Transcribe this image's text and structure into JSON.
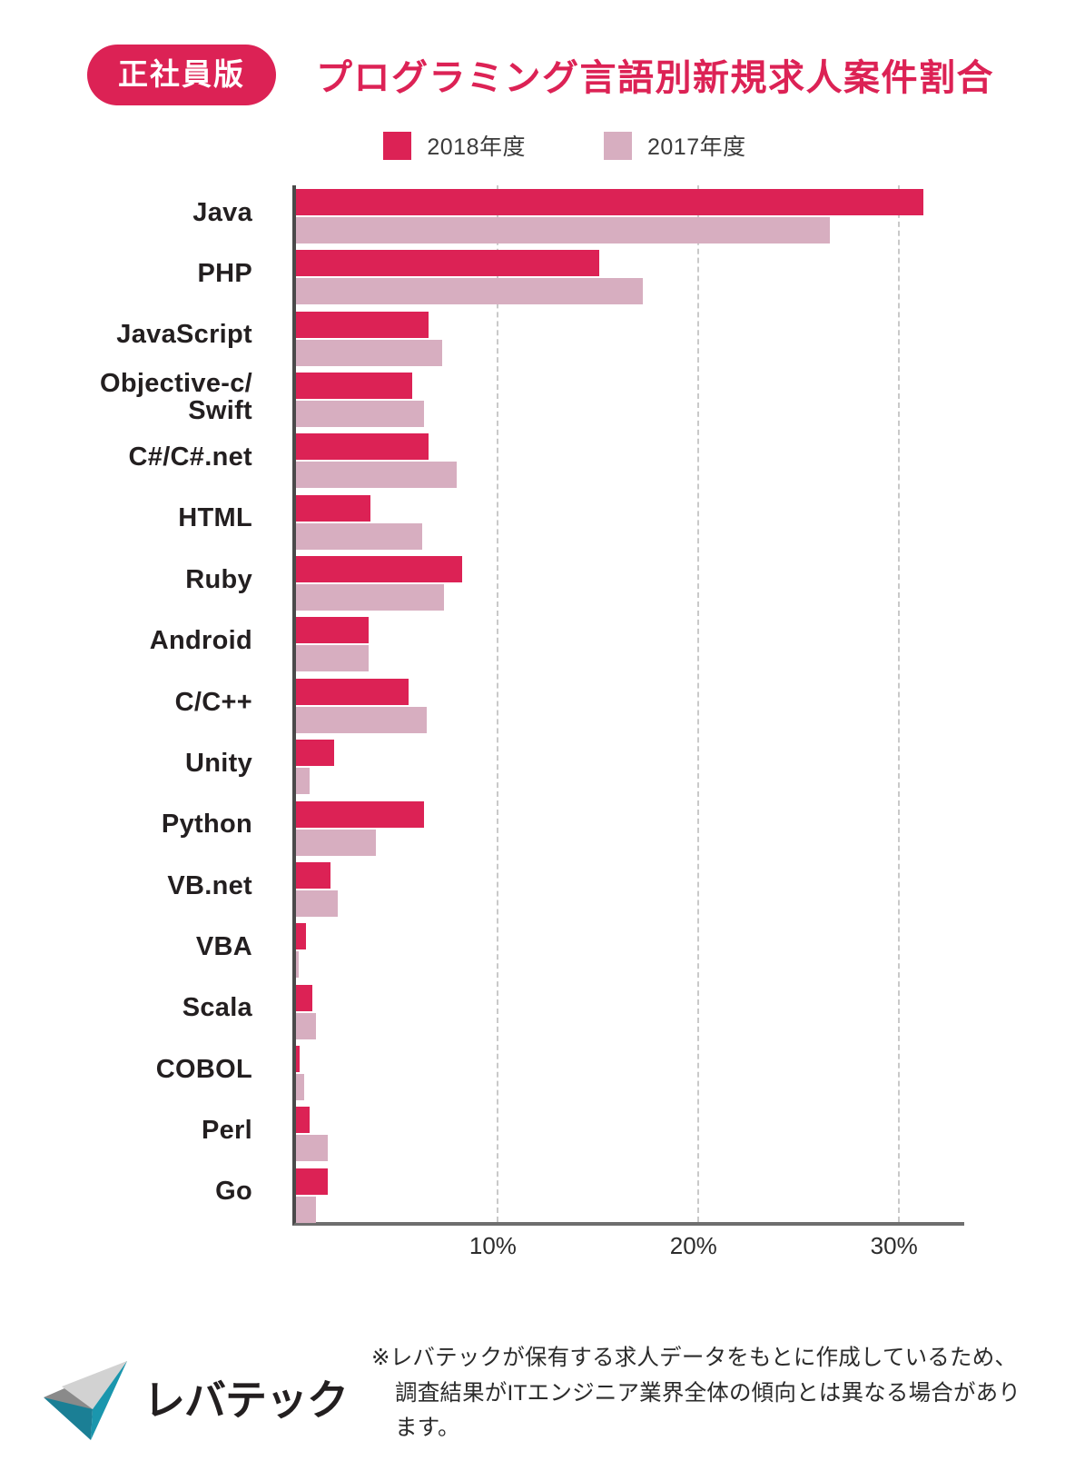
{
  "header": {
    "badge": "正社員版",
    "title": "プログラミング言語別新規求人案件割合"
  },
  "legend": {
    "items": [
      {
        "label": "2018年度",
        "color": "#DC2255",
        "swatch_name": "legend-swatch-2018"
      },
      {
        "label": "2017年度",
        "color": "#D7AEC0",
        "swatch_name": "legend-swatch-2017"
      }
    ]
  },
  "footer": {
    "logo_text": "レバテック",
    "logo_mark": "levtech-arrow-logo",
    "note_line_1": "※レバテックが保有する求人データをもとに作成しているため、",
    "note_line_2": "調査結果がITエンジニア業界全体の傾向とは異なる場合があります。"
  },
  "chart_data": {
    "type": "bar",
    "orientation": "horizontal",
    "title": "プログラミング言語別新規求人案件割合",
    "xlabel": "",
    "ylabel": "",
    "xlim": [
      0,
      33.5
    ],
    "grid": true,
    "gridlines": [
      10,
      20,
      30
    ],
    "tick_labels": [
      "10%",
      "20%",
      "30%"
    ],
    "legend_position": "top-center",
    "categories": [
      "Java",
      "PHP",
      "JavaScript",
      "Objective-c/\nSwift",
      "C#/C#.net",
      "HTML",
      "Ruby",
      "Android",
      "C/C++",
      "Unity",
      "Python",
      "VB.net",
      "VBA",
      "Scala",
      "COBOL",
      "Perl",
      "Go"
    ],
    "series": [
      {
        "name": "2018年度",
        "color": "#DC2255",
        "values": [
          31.3,
          15.1,
          6.6,
          5.8,
          6.6,
          3.7,
          8.3,
          3.6,
          5.6,
          1.9,
          6.4,
          1.7,
          0.5,
          0.8,
          0.2,
          0.7,
          1.6
        ]
      },
      {
        "name": "2017年度",
        "color": "#D7AEC0",
        "values": [
          26.6,
          17.3,
          7.3,
          6.4,
          8.0,
          6.3,
          7.4,
          3.6,
          6.5,
          0.7,
          4.0,
          2.1,
          0.15,
          1.0,
          0.4,
          1.6,
          1.0
        ]
      }
    ]
  }
}
